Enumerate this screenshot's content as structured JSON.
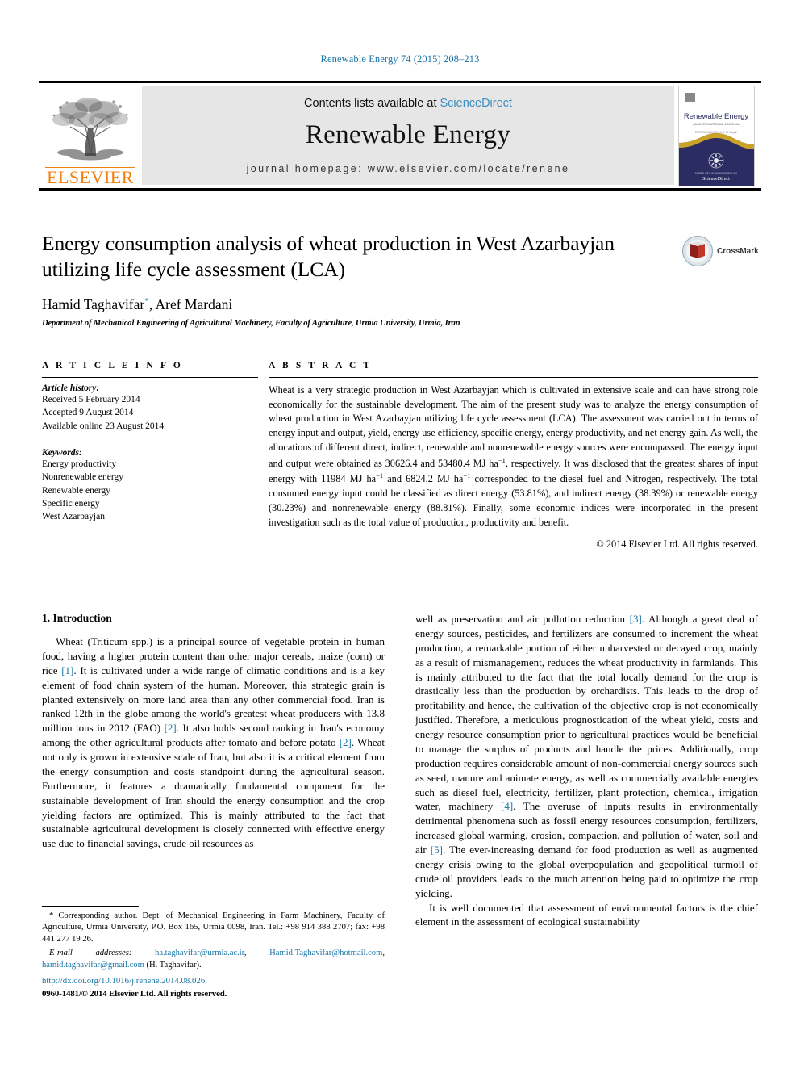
{
  "running_head": "Renewable Energy 74 (2015) 208–213",
  "masthead": {
    "publisher_name": "ELSEVIER",
    "contents_prefix": "Contents lists available at ",
    "sciencedirect": "ScienceDirect",
    "journal_title": "Renewable Energy",
    "homepage": "journal homepage: www.elsevier.com/locate/renene",
    "cover": {
      "title": "Renewable Energy",
      "subtitle": "AN INTERNATIONAL JOURNAL",
      "editors": "EDITORS-IN-CHIEF: A. A. M. Sayigh",
      "brand": "ScienceDirect"
    }
  },
  "article": {
    "title": "Energy consumption analysis of wheat production in West Azarbayjan utilizing life cycle assessment (LCA)",
    "authors": "Hamid Taghavifar",
    "author_marker": "*",
    "authors_rest": ", Aref Mardani",
    "affiliation": "Department of Mechanical Engineering of Agricultural Machinery, Faculty of Agriculture, Urmia University, Urmia, Iran",
    "crossmark_label": "CrossMark"
  },
  "article_info": {
    "heading": "A R T I C L E   I N F O",
    "history_label": "Article history:",
    "history": [
      "Received 5 February 2014",
      "Accepted 9 August 2014",
      "Available online 23 August 2014"
    ],
    "keywords_label": "Keywords:",
    "keywords": [
      "Energy productivity",
      "Nonrenewable energy",
      "Renewable energy",
      "Specific energy",
      "West Azarbayjan"
    ]
  },
  "abstract": {
    "heading": "A B S T R A C T",
    "text_part1": "Wheat is a very strategic production in West Azarbayjan which is cultivated in extensive scale and can have strong role economically for the sustainable development. The aim of the present study was to analyze the energy consumption of wheat production in West Azarbayjan utilizing life cycle assessment (LCA). The assessment was carried out in terms of energy input and output, yield, energy use efficiency, specific energy, energy productivity, and net energy gain. As well, the allocations of different direct, indirect, renewable and nonrenewable energy sources were encompassed. The energy input and output were obtained as 30626.4 and 53480.4 MJ ha",
    "sup1": "−1",
    "text_part2": ", respectively. It was disclosed that the greatest shares of input energy with 11984 MJ ha",
    "sup2": "−1",
    "text_part3": " and 6824.2 MJ ha",
    "sup3": "−1",
    "text_part4": " corresponded to the diesel fuel and Nitrogen, respectively. The total consumed energy input could be classified as direct energy (53.81%), and indirect energy (38.39%) or renewable energy (30.23%) and nonrenewable energy (88.81%). Finally, some economic indices were incorporated in the present investigation such as the total value of production, productivity and benefit.",
    "copyright": "© 2014 Elsevier Ltd. All rights reserved."
  },
  "intro": {
    "heading": "1. Introduction",
    "left_p1_a": "Wheat (Triticum spp.) is a principal source of vegetable protein in human food, having a higher protein content than other major cereals, maize (corn) or rice ",
    "ref1": "[1]",
    "left_p1_b": ". It is cultivated under a wide range of climatic conditions and is a key element of food chain system of the human. Moreover, this strategic grain is planted extensively on more land area than any other commercial food. Iran is ranked 12th in the globe among the world's greatest wheat producers with 13.8 million tons in 2012 (FAO) ",
    "ref2": "[2]",
    "left_p1_c": ". It also holds second ranking in Iran's economy among the other agricultural products after tomato and before potato ",
    "ref2b": "[2]",
    "left_p1_d": ". Wheat not only is grown in extensive scale of Iran, but also it is a critical element from the energy consumption and costs standpoint during the agricultural season. Furthermore, it features a dramatically fundamental component for the sustainable development of Iran should the energy consumption and the crop yielding factors are optimized. This is mainly attributed to the fact that sustainable agricultural development is closely connected with effective energy use due to financial savings, crude oil resources as",
    "right_p1_a": "well as preservation and air pollution reduction ",
    "ref3": "[3]",
    "right_p1_b": ". Although a great deal of energy sources, pesticides, and fertilizers are consumed to increment the wheat production, a remarkable portion of either unharvested or decayed crop, mainly as a result of mismanagement, reduces the wheat productivity in farmlands. This is mainly attributed to the fact that the total locally demand for the crop is drastically less than the production by orchardists. This leads to the drop of profitability and hence, the cultivation of the objective crop is not economically justified. Therefore, a meticulous prognostication of the wheat yield, costs and energy resource consumption prior to agricultural practices would be beneficial to manage the surplus of products and handle the prices. Additionally, crop production requires considerable amount of non-commercial energy sources such as seed, manure and animate energy, as well as commercially available energies such as diesel fuel, electricity, fertilizer, plant protection, chemical, irrigation water, machinery ",
    "ref4": "[4]",
    "right_p1_c": ". The overuse of inputs results in environmentally detrimental phenomena such as fossil energy resources consumption, fertilizers, increased global warming, erosion, compaction, and pollution of water, soil and air ",
    "ref5": "[5]",
    "right_p1_d": ". The ever-increasing demand for food production as well as augmented energy crisis owing to the global overpopulation and geopolitical turmoil of crude oil providers leads to the much attention being paid to optimize the crop yielding.",
    "right_p2": "It is well documented that assessment of environmental factors is the chief element in the assessment of ecological sustainability"
  },
  "footnote": {
    "marker": "*",
    "corresponding": " Corresponding author. Dept. of Mechanical Engineering in Farm Machinery, Faculty of Agriculture, Urmia University, P.O. Box 165, Urmia 0098, Iran. Tel.: +98 914 388 2707; fax: +98 441 277 19 26.",
    "email_label": "E-mail addresses:",
    "email1": "ha.taghavifar@urmia.ac.ir",
    "email2": "Hamid.Taghavifar@hotmail.com",
    "email3": "hamid.taghavifar@gmail.com",
    "email_suffix": " (H. Taghavifar)."
  },
  "doc_footer": {
    "doi": "http://dx.doi.org/10.1016/j.renene.2014.08.026",
    "issn_line": "0960-1481/© 2014 Elsevier Ltd. All rights reserved."
  },
  "colors": {
    "link_blue": "#1a76a8",
    "elsevier_orange": "#f08010",
    "banner_gray": "#e6e6e6",
    "cover_navy": "#2b2d62",
    "cover_gold": "#c9a227",
    "crossmark_red": "#c0392b"
  }
}
